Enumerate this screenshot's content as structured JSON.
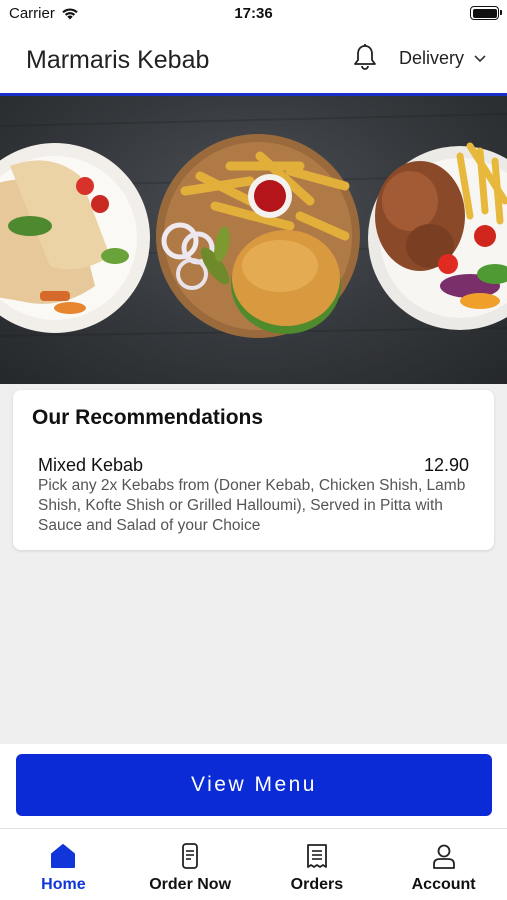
{
  "status_bar": {
    "carrier": "Carrier",
    "time": "17:36"
  },
  "header": {
    "title": "Marmaris Kebab",
    "mode_selector": "Delivery"
  },
  "recommendations": {
    "title": "Our Recommendations",
    "items": [
      {
        "name": "Mixed Kebab",
        "price": "12.90",
        "description": "Pick any 2x Kebabs from (Doner Kebab, Chicken Shish, Lamb Shish, Kofte Shish or Grilled Halloumi), Served in Pitta with Sauce and Salad of your Choice"
      }
    ]
  },
  "cta": {
    "view_menu_label": "View Menu"
  },
  "tabs": [
    {
      "label": "Home",
      "icon": "home-icon",
      "active": true
    },
    {
      "label": "Order Now",
      "icon": "order-now-icon",
      "active": false
    },
    {
      "label": "Orders",
      "icon": "receipt-icon",
      "active": false
    },
    {
      "label": "Account",
      "icon": "person-icon",
      "active": false
    }
  ],
  "colors": {
    "accent": "#0a2bd6",
    "active_tab": "#1035d9",
    "header_rule": "#1a2fc9"
  }
}
